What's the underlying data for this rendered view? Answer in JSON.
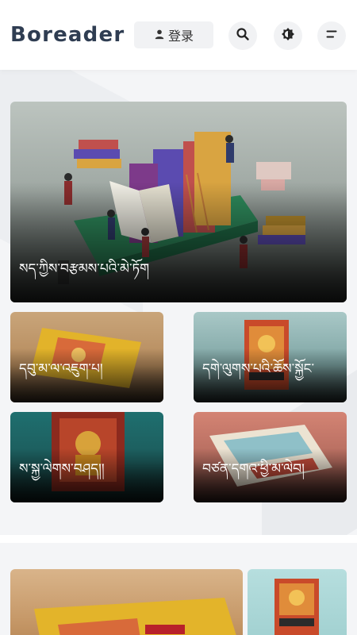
{
  "header": {
    "logo": "Boreader",
    "login_label": "登录",
    "icons": [
      "user-icon",
      "search-icon",
      "theme-toggle-icon",
      "menu-icon"
    ]
  },
  "colors": {
    "logo": "#2f3d52",
    "button_bg": "#f1f2f4",
    "page_bg": "#f4f5f7"
  },
  "featured": {
    "hero_title": "སད་ཀྱིས་བརྩམས་པའི་མེ་ཏོག",
    "cards": [
      {
        "title": "དབུ་མ་ལ་འཇུག་པ།"
      },
      {
        "title": "དགེ་ལུགས་པའི་ཆོས་སྐྱོང་"
      },
      {
        "title": "ས་སྐྱ་ལེགས་བཤད།།"
      },
      {
        "title": "བཙན་དགའ་ཕྱི་མ་ལེབ།"
      }
    ]
  }
}
